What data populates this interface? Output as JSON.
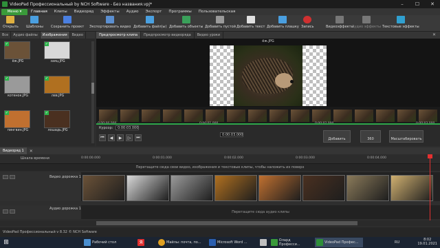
{
  "window": {
    "title": "VideoPad Профессиональный by NCH Software - Без названия.vpj*",
    "min": "–",
    "max": "☐",
    "close": "✕"
  },
  "menu": {
    "main_button": "Меню ▾",
    "items": [
      "Главная",
      "Клипы",
      "Видеоряд",
      "Эффекты",
      "Аудио",
      "Экспорт",
      "Программы",
      "Пользовательская"
    ]
  },
  "ribbon": [
    {
      "label": "Открыть",
      "color": "#e0b040"
    },
    {
      "label": "Шаблоны",
      "color": "#4a9fe0"
    },
    {
      "label": "Сохранить проект",
      "color": "#4a7fe0"
    },
    {
      "label": "Экспортировать видео",
      "color": "#5b8fd0"
    },
    {
      "label": "Добавить файл(ы)",
      "color": "#4aa0e0"
    },
    {
      "label": "Добавить объекты",
      "color": "#3aa05a"
    },
    {
      "label": "Добавить пустой",
      "color": "#9a9a9a"
    },
    {
      "label": "Добавить текст",
      "color": "#e0e0e0"
    },
    {
      "label": "Добавить плашку",
      "color": "#4a9fe0"
    },
    {
      "label": "Запись",
      "color": "#d03030"
    },
    {
      "label": "Видеоэффекты",
      "color": "#777777"
    },
    {
      "label": "Аудио эффекты",
      "color": "#777777"
    },
    {
      "label": "Текстовые эффекты",
      "color": "#30a0d0"
    }
  ],
  "media_tabs": [
    "Все",
    "Аудио файлы",
    "Изображения",
    "Видео"
  ],
  "media_items": [
    {
      "label": "ёж.JPG",
      "color": "#6b5238"
    },
    {
      "label": "заяц.JPG",
      "color": "#d8d8d8"
    },
    {
      "label": "котенок.JPG",
      "color": "#9a9a9a"
    },
    {
      "label": "лев.JPG",
      "color": "#b07020"
    },
    {
      "label": "пингвин.JPG",
      "color": "#c07030"
    },
    {
      "label": "лошадь.JPG",
      "color": "#4a3020"
    }
  ],
  "preview": {
    "tabs": [
      "Предпросмотр клипа",
      "Предпросмотр видеоряда",
      "Видео уроки"
    ],
    "clip_name": "ёж.JPG",
    "film_labels": [
      "0:00:00.000",
      "0:00:01.000",
      "0:00:02.000",
      "0:00:03.000"
    ],
    "cursor_label": "Курсор:",
    "cursor_value": "0:00:03.000",
    "end_time": "0:00:03.000",
    "add_button": "Добавить",
    "button_360": "360",
    "scale_button": "Масштабировать",
    "close": "✕"
  },
  "timeline": {
    "sequence_tab": "Видеоряд 1",
    "sequence_close": "✕",
    "ruler_label": "Шкала времени",
    "ticks": [
      "0:00:00.000",
      "0:00:01.000",
      "0:00:02.000",
      "0:00:03.000",
      "0:00:04.000"
    ],
    "video_hint": "Перетащите сюда свои видео, изображения и текстовые клипы, чтобы наложить их поверх",
    "video_track": "Видео дорожка 1",
    "audio_track": "Аудио дорожка 1",
    "audio_hint": "Перетащите сюда аудио клипы",
    "clip_colors": [
      "#6b5238",
      "#d8d8d8",
      "#9a9a9a",
      "#b07020",
      "#c07030",
      "#4a3020",
      "#8a7a5a",
      "#d0b070"
    ]
  },
  "status": "VideoPad Профессиональный v 8.32 © NCH Software",
  "taskbar": {
    "items": [
      "Рабочий стол",
      "Я",
      "Майлы: почта, по...",
      "Microsoft Word ...",
      "",
      "Олард Професси...",
      "VideoPad Профес..."
    ],
    "lang": "RU",
    "time": "8:02",
    "date": "19.01.2021"
  }
}
